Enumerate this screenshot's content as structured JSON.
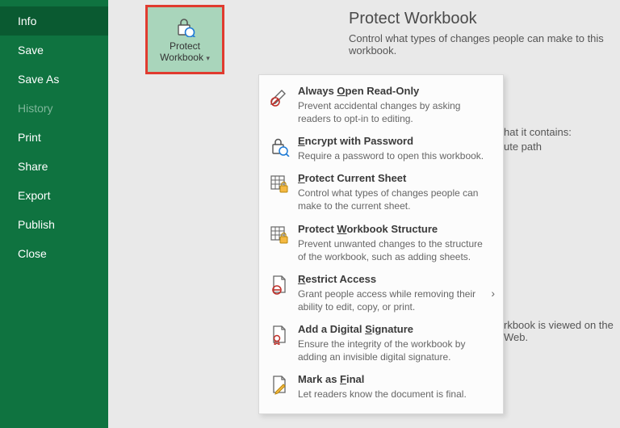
{
  "sidebar": {
    "items": [
      {
        "label": "Info",
        "state": "selected"
      },
      {
        "label": "Save",
        "state": ""
      },
      {
        "label": "Save As",
        "state": ""
      },
      {
        "label": "History",
        "state": "disabled"
      },
      {
        "label": "Print",
        "state": ""
      },
      {
        "label": "Share",
        "state": ""
      },
      {
        "label": "Export",
        "state": ""
      },
      {
        "label": "Publish",
        "state": ""
      },
      {
        "label": "Close",
        "state": ""
      }
    ]
  },
  "protectButton": {
    "line1": "Protect",
    "line2": "Workbook"
  },
  "header": {
    "title": "Protect Workbook",
    "subtitle": "Control what types of changes people can make to this workbook."
  },
  "bgSnippets": {
    "a": "hat it contains:",
    "b": "ute path",
    "c": "rkbook is viewed on the Web."
  },
  "menu": [
    {
      "titleParts": [
        "Always ",
        "O",
        "pen Read-Only"
      ],
      "desc": "Prevent accidental changes by asking readers to opt-in to editing.",
      "icon": "pencil-block",
      "chevron": false
    },
    {
      "titleParts": [
        "",
        "E",
        "ncrypt with Password"
      ],
      "desc": "Require a password to open this workbook.",
      "icon": "lock-key",
      "chevron": false
    },
    {
      "titleParts": [
        "",
        "P",
        "rotect Current Sheet"
      ],
      "desc": "Control what types of changes people can make to the current sheet.",
      "icon": "sheet-lock",
      "chevron": false
    },
    {
      "titleParts": [
        "Protect ",
        "W",
        "orkbook Structure"
      ],
      "desc": "Prevent unwanted changes to the structure of the workbook, such as adding sheets.",
      "icon": "book-lock",
      "chevron": false
    },
    {
      "titleParts": [
        "",
        "R",
        "estrict Access"
      ],
      "desc": "Grant people access while removing their ability to edit, copy, or print.",
      "icon": "doc-restrict",
      "chevron": true
    },
    {
      "titleParts": [
        "Add a Digital ",
        "S",
        "ignature"
      ],
      "desc": "Ensure the integrity of the workbook by adding an invisible digital signature.",
      "icon": "doc-ribbon",
      "chevron": false
    },
    {
      "titleParts": [
        "Mark as ",
        "F",
        "inal"
      ],
      "desc": "Let readers know the document is final.",
      "icon": "doc-pen",
      "chevron": false
    }
  ],
  "icons": {
    "pencil-block": "pencil-block-icon",
    "lock-key": "lock-key-icon",
    "sheet-lock": "sheet-lock-icon",
    "book-lock": "book-lock-icon",
    "doc-restrict": "doc-restrict-icon",
    "doc-ribbon": "doc-ribbon-icon",
    "doc-pen": "doc-pen-icon"
  },
  "colors": {
    "sidebar": "#0f7340",
    "sidebarSelected": "#0a5a31",
    "highlight": "#e03b2f",
    "menuBg": "#fcfcfc"
  }
}
